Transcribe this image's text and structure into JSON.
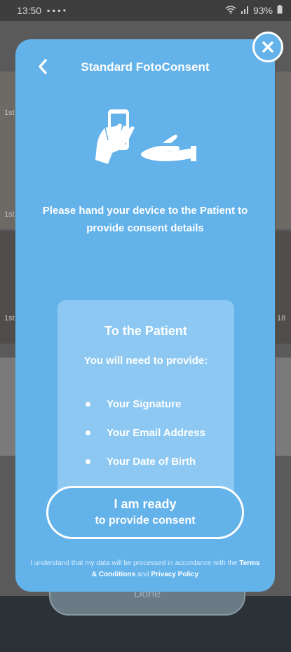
{
  "status_bar": {
    "time": "13:50",
    "battery": "93%"
  },
  "background": {
    "done_label": "Done",
    "photo_labels": [
      "1st",
      "1st",
      "1st",
      "18"
    ]
  },
  "modal": {
    "title": "Standard FotoConsent",
    "instructions": "Please hand your device to the Patient to provide consent details",
    "card": {
      "title": "To the Patient",
      "subtitle": "You will need to provide:",
      "items": [
        "Your Signature",
        "Your Email Address",
        "Your Date of Birth"
      ]
    },
    "ready_button": {
      "line1": "I am ready",
      "line2": "to provide consent"
    },
    "legal": {
      "prefix": "I understand that my data will be processed in accordance with the",
      "terms_link": "Terms & Conditions",
      "and": "and",
      "privacy_link": "Privacy Policy"
    }
  },
  "colors": {
    "modal_bg": "#63b2ea",
    "card_bg": "#8cc8f2",
    "text": "#ffffff"
  },
  "icons": [
    "back-arrow-icon",
    "close-icon",
    "hand-phone-icon",
    "open-hand-icon",
    "wifi-icon",
    "signal-icon",
    "battery-icon"
  ]
}
